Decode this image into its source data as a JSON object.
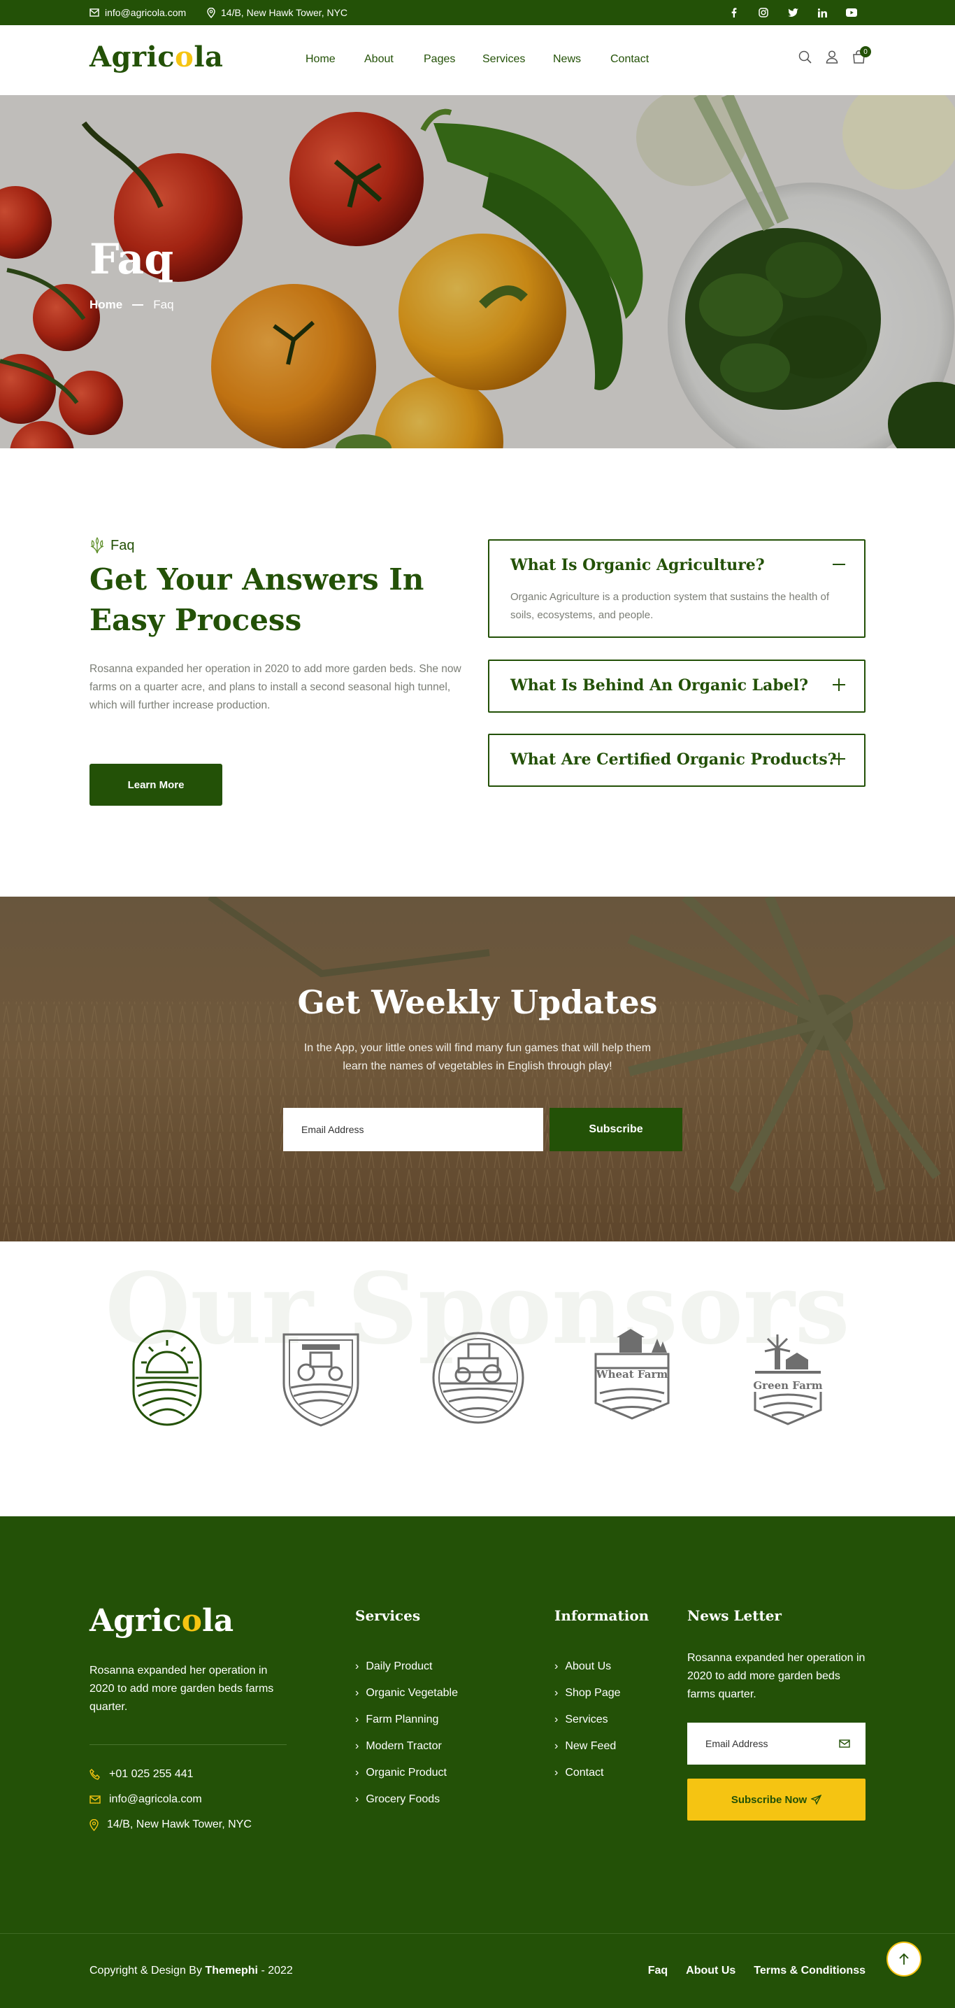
{
  "topbar": {
    "email": "info@agricola.com",
    "address": "14/B, New Hawk Tower, NYC",
    "social": [
      "facebook-icon",
      "instagram-icon",
      "twitter-icon",
      "linkedin-icon",
      "youtube-icon"
    ]
  },
  "header": {
    "logo": "Agricola",
    "nav": [
      "Home",
      "About",
      "Pages",
      "Services",
      "News",
      "Contact"
    ],
    "cart_count": "0"
  },
  "hero": {
    "title": "Faq",
    "breadcrumb_home": "Home",
    "breadcrumb_current": "Faq"
  },
  "faq": {
    "tag": "Faq",
    "heading": "Get Your Answers In Easy Process",
    "paragraph_1": "Rosanna expanded her operation in 2020 to add more garden beds. She now",
    "paragraph_2": "farms on a quarter acre, and plans to install a second seasonal high tunnel, which will further increase production.",
    "button": "Learn More",
    "items": [
      {
        "question": "What Is Organic Agriculture?",
        "answer": "Organic Agriculture is a production system that sustains the health of soils, ecosystems, and people.",
        "open": true
      },
      {
        "question": "What Is Behind An Organic Label?",
        "answer": "",
        "open": false
      },
      {
        "question": "What Are Certified Organic Products?",
        "answer": "",
        "open": false
      }
    ]
  },
  "newsletter": {
    "title": "Get Weekly Updates",
    "text": "In the App, your little ones will find many fun games that will help them learn the names of vegetables in English through play!",
    "placeholder": "Email Address",
    "button": "Subscribe"
  },
  "sponsors": {
    "watermark": "Our Sponsors",
    "logos": [
      {
        "name": "sunrise-farm-logo",
        "label": ""
      },
      {
        "name": "tractor-shield-logo",
        "label": ""
      },
      {
        "name": "tractor-circle-logo",
        "label": ""
      },
      {
        "name": "wheat-farm-logo",
        "label": "Wheat Farm"
      },
      {
        "name": "green-farm-logo",
        "label": "Green Farm"
      }
    ]
  },
  "footer": {
    "logo": "Agricola",
    "description": "Rosanna expanded her operation in 2020 to add more garden beds farms quarter.",
    "phone": "+01 025 255 441",
    "email": "info@agricola.com",
    "address": "14/B, New Hawk Tower, NYC",
    "services_title": "Services",
    "services": [
      "Daily Product",
      "Organic Vegetable",
      "Farm Planning",
      "Modern Tractor",
      "Organic Product",
      "Grocery Foods"
    ],
    "information_title": "Information",
    "information": [
      "About Us",
      "Shop Page",
      "Services",
      "New Feed",
      "Contact"
    ],
    "news_title": "News Letter",
    "news_text": "Rosanna expanded her operation in 2020 to add more garden beds farms quarter.",
    "news_placeholder": "Email Address",
    "news_button": "Subscribe Now",
    "copyright_prefix": "Copyright & Design By",
    "copyright_brand": "Themephi",
    "copyright_year": "- 2022",
    "bottom_links": [
      "Faq",
      "About Us",
      "Terms & Conditionss"
    ]
  },
  "colors": {
    "brand_green": "#235107",
    "accent_yellow": "#f5c412",
    "muted_text": "#7b7e76"
  }
}
